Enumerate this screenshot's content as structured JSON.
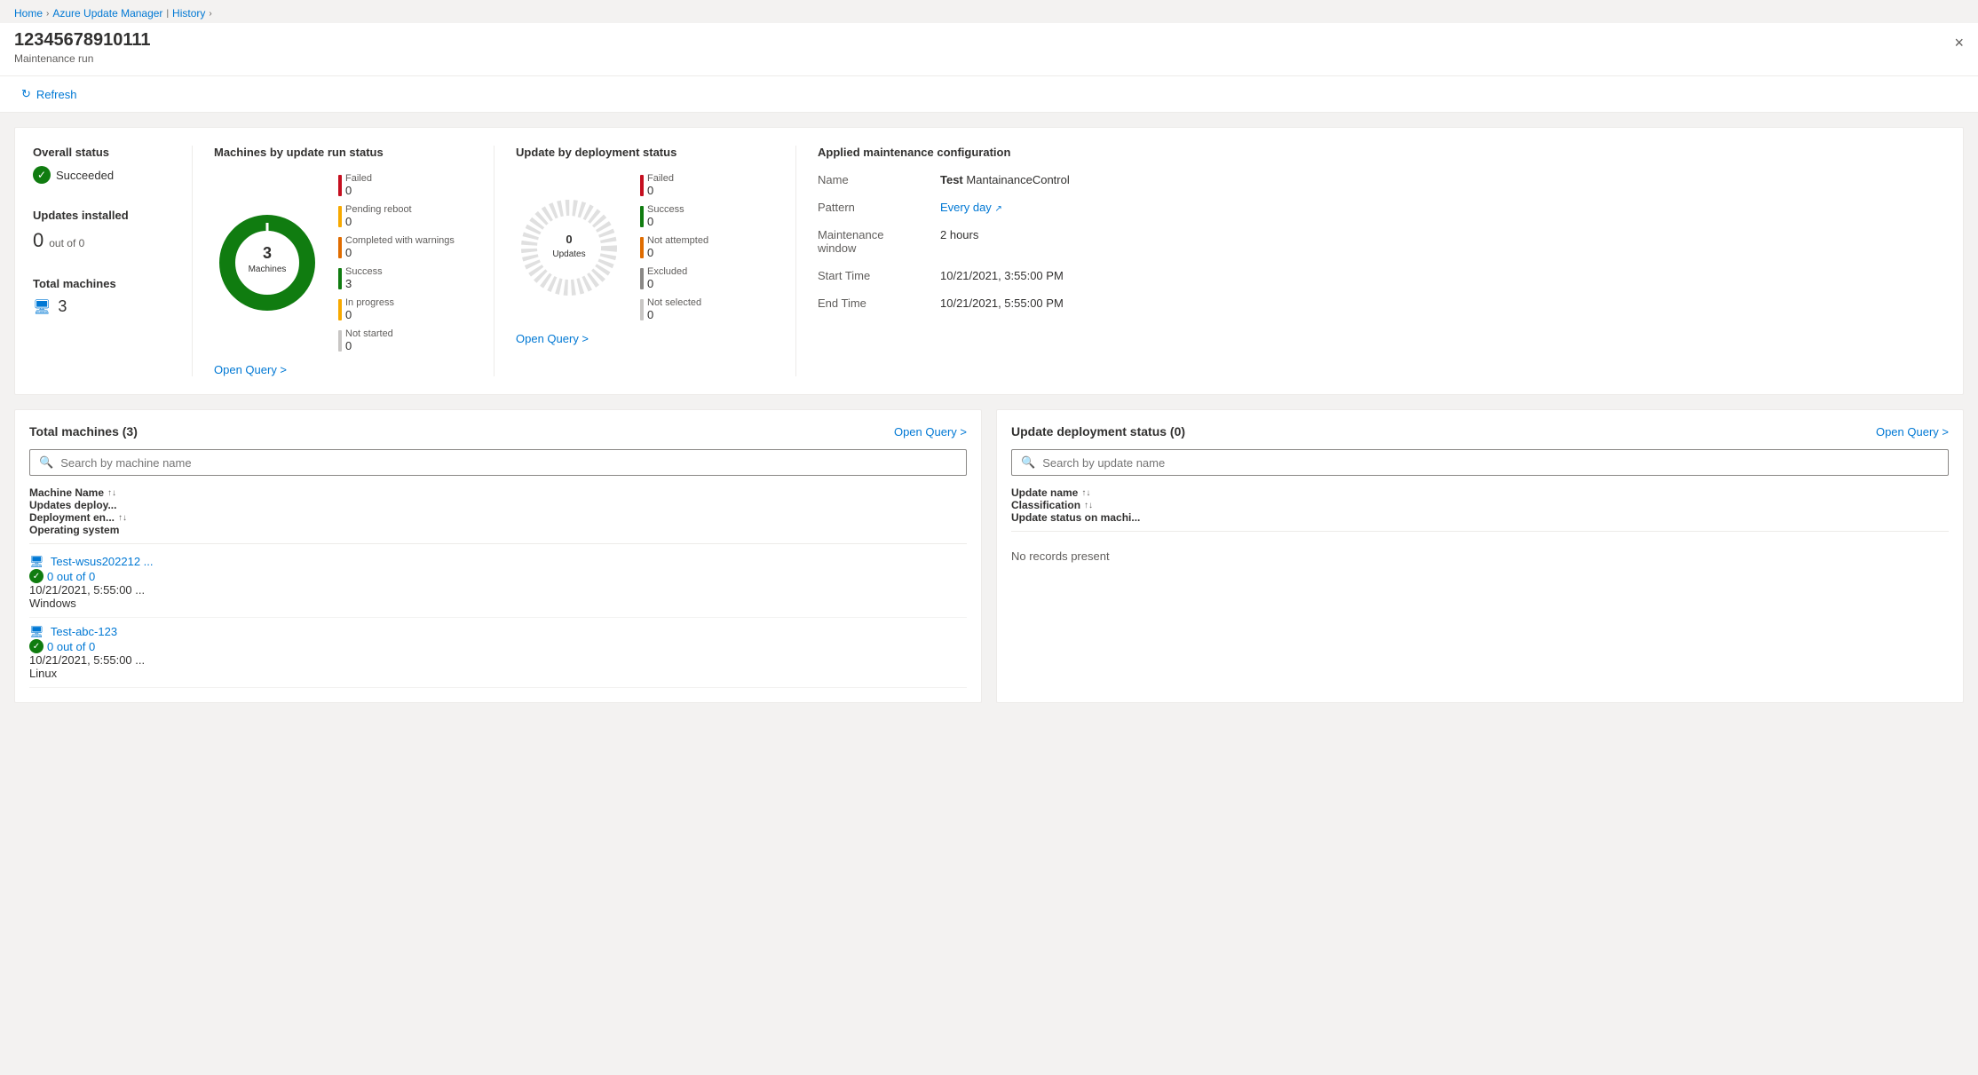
{
  "breadcrumb": {
    "home": "Home",
    "azure_update_manager": "Azure Update Manager",
    "history": "History"
  },
  "page": {
    "title": "12345678910111",
    "subtitle": "Maintenance run",
    "close_label": "×"
  },
  "toolbar": {
    "refresh_label": "Refresh"
  },
  "header_tab": "Azure Update Manager History",
  "overall_status": {
    "label": "Overall status",
    "status": "Succeeded",
    "updates_installed_label": "Updates installed",
    "updates_value": "0",
    "updates_suffix": "out of 0",
    "total_machines_label": "Total machines",
    "machines_count": "3"
  },
  "machines_chart": {
    "title": "Machines by update run status",
    "center_value": "3",
    "center_label": "Machines",
    "legend": [
      {
        "label": "Failed",
        "value": "0",
        "color": "#c50f1f"
      },
      {
        "label": "Pending reboot",
        "value": "0",
        "color": "#f7a900"
      },
      {
        "label": "Completed with warnings",
        "value": "0",
        "color": "#e06c00"
      },
      {
        "label": "Success",
        "value": "3",
        "color": "#107c10"
      },
      {
        "label": "In progress",
        "value": "0",
        "color": "#f7a900"
      },
      {
        "label": "Not started",
        "value": "0",
        "color": "#c8c6c4"
      }
    ],
    "open_query": "Open Query >"
  },
  "deployment_chart": {
    "title": "Update by deployment status",
    "center_value": "0 Updates",
    "legend": [
      {
        "label": "Failed",
        "value": "0",
        "color": "#c50f1f"
      },
      {
        "label": "Success",
        "value": "0",
        "color": "#107c10"
      },
      {
        "label": "Not attempted",
        "value": "0",
        "color": "#e06c00"
      },
      {
        "label": "Excluded",
        "value": "0",
        "color": "#8a8886"
      },
      {
        "label": "Not selected",
        "value": "0",
        "color": "#c8c6c4"
      }
    ],
    "open_query": "Open Query >"
  },
  "config": {
    "title": "Applied maintenance configuration",
    "name_label": "Name",
    "name_prefix": "Test",
    "name_value": "MantainanceControl",
    "pattern_label": "Pattern",
    "pattern_value": "Every day",
    "window_label": "Maintenance window",
    "window_value": "2 hours",
    "start_label": "Start Time",
    "start_value": "10/21/2021, 3:55:00 PM",
    "end_label": "End Time",
    "end_value": "10/21/2021, 5:55:00 PM"
  },
  "machines_panel": {
    "title": "Total machines (3)",
    "open_query": "Open Query >",
    "search_placeholder": "Search by machine name",
    "columns": [
      "Machine Name",
      "Updates deploy...",
      "Deployment en...",
      "Operating system"
    ],
    "rows": [
      {
        "name": "Test-wsus202212 ...",
        "updates": "0 out of 0",
        "deployment_end": "10/21/2021, 5:55:00 ...",
        "os": "Windows"
      },
      {
        "name": "Test-abc-123",
        "updates": "0 out of 0",
        "deployment_end": "10/21/2021, 5:55:00 ...",
        "os": "Linux"
      }
    ]
  },
  "updates_panel": {
    "title": "Update deployment status (0)",
    "open_query": "Open Query >",
    "search_placeholder": "Search by update name",
    "columns": [
      "Update name",
      "Classification",
      "Update status on machi..."
    ],
    "no_records": "No records present"
  }
}
